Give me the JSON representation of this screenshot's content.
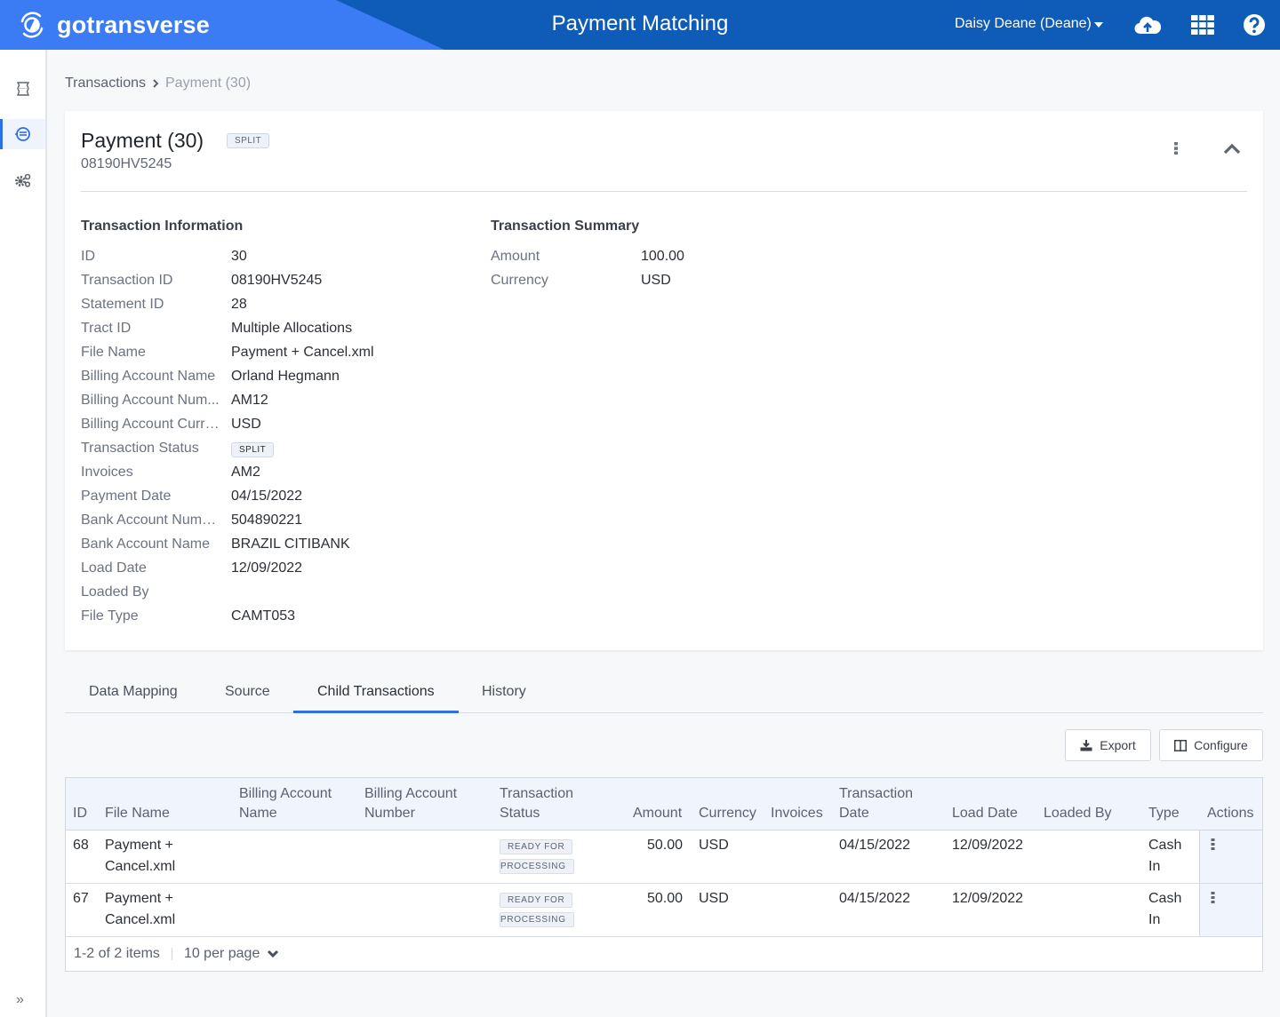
{
  "header": {
    "logo_text": "gotransverse",
    "title": "Payment Matching",
    "user": "Daisy Deane (Deane)",
    "icons": [
      "cloud-upload-icon",
      "apps-grid-icon",
      "help-icon"
    ]
  },
  "sidebar": {
    "items": [
      {
        "name": "transactions-icon",
        "active": false
      },
      {
        "name": "payment-matching-icon",
        "active": true
      },
      {
        "name": "settings-icon",
        "active": false
      }
    ],
    "expand_label": "»"
  },
  "breadcrumb": {
    "parent": "Transactions",
    "current": "Payment (30)"
  },
  "card": {
    "title": "Payment (30)",
    "status_badge": "SPLIT",
    "subtitle": "08190HV5245",
    "transaction_information": {
      "title": "Transaction Information",
      "fields": [
        {
          "label": "ID",
          "value": "30"
        },
        {
          "label": "Transaction ID",
          "value": "08190HV5245"
        },
        {
          "label": "Statement ID",
          "value": "28"
        },
        {
          "label": "Tract ID",
          "value": "Multiple Allocations"
        },
        {
          "label": "File Name",
          "value": "Payment + Cancel.xml"
        },
        {
          "label": "Billing Account Name",
          "value": "Orland Hegmann"
        },
        {
          "label": "Billing Account Num...",
          "value": "AM12"
        },
        {
          "label": "Billing Account Curre...",
          "value": "USD"
        },
        {
          "label": "Transaction Status",
          "value": "SPLIT",
          "badge": true
        },
        {
          "label": "Invoices",
          "value": "AM2"
        },
        {
          "label": "Payment Date",
          "value": "04/15/2022"
        },
        {
          "label": "Bank Account Number",
          "value": "504890221"
        },
        {
          "label": "Bank Account Name",
          "value": "BRAZIL CITIBANK"
        },
        {
          "label": "Load Date",
          "value": "12/09/2022"
        },
        {
          "label": "Loaded By",
          "value": ""
        },
        {
          "label": "File Type",
          "value": "CAMT053"
        }
      ]
    },
    "transaction_summary": {
      "title": "Transaction Summary",
      "fields": [
        {
          "label": "Amount",
          "value": "100.00"
        },
        {
          "label": "Currency",
          "value": "USD"
        }
      ]
    }
  },
  "tabs": [
    {
      "label": "Data Mapping",
      "active": false
    },
    {
      "label": "Source",
      "active": false
    },
    {
      "label": "Child Transactions",
      "active": true
    },
    {
      "label": "History",
      "active": false
    }
  ],
  "toolbar": {
    "export_label": "Export",
    "configure_label": "Configure"
  },
  "table": {
    "columns": [
      {
        "key": "id",
        "label": "ID"
      },
      {
        "key": "file_name",
        "label": "File Name"
      },
      {
        "key": "billing_account_name",
        "label": "Billing Account Name",
        "line1": "Billing Account",
        "line2": "Name"
      },
      {
        "key": "billing_account_number",
        "label": "Billing Account Number",
        "line1": "Billing Account",
        "line2": "Number"
      },
      {
        "key": "transaction_status",
        "label": "Transaction Status",
        "line1": "Transaction",
        "line2": "Status"
      },
      {
        "key": "amount",
        "label": "Amount"
      },
      {
        "key": "currency",
        "label": "Currency"
      },
      {
        "key": "invoices",
        "label": "Invoices"
      },
      {
        "key": "transaction_date",
        "label": "Transaction Date",
        "line1": "Transaction",
        "line2": "Date"
      },
      {
        "key": "load_date",
        "label": "Load Date"
      },
      {
        "key": "loaded_by",
        "label": "Loaded By"
      },
      {
        "key": "type",
        "label": "Type"
      },
      {
        "key": "actions",
        "label": "Actions"
      }
    ],
    "rows": [
      {
        "id": "68",
        "file_name_1": "Payment +",
        "file_name_2": "Cancel.xml",
        "billing_account_name": "",
        "billing_account_number": "",
        "status_1": "READY FOR",
        "status_2": "PROCESSING",
        "amount": "50.00",
        "currency": "USD",
        "invoices": "",
        "transaction_date": "04/15/2022",
        "load_date": "12/09/2022",
        "loaded_by": "",
        "type_1": "Cash",
        "type_2": "In"
      },
      {
        "id": "67",
        "file_name_1": "Payment +",
        "file_name_2": "Cancel.xml",
        "billing_account_name": "",
        "billing_account_number": "",
        "status_1": "READY FOR",
        "status_2": "PROCESSING",
        "amount": "50.00",
        "currency": "USD",
        "invoices": "",
        "transaction_date": "04/15/2022",
        "load_date": "12/09/2022",
        "loaded_by": "",
        "type_1": "Cash",
        "type_2": "In"
      }
    ],
    "footer": {
      "range": "1-2 of 2 items",
      "per_page": "10 per page"
    }
  },
  "colors": {
    "header_dark": "#0e5bb8",
    "header_light": "#3b7cf5",
    "accent": "#2f6fe4"
  }
}
